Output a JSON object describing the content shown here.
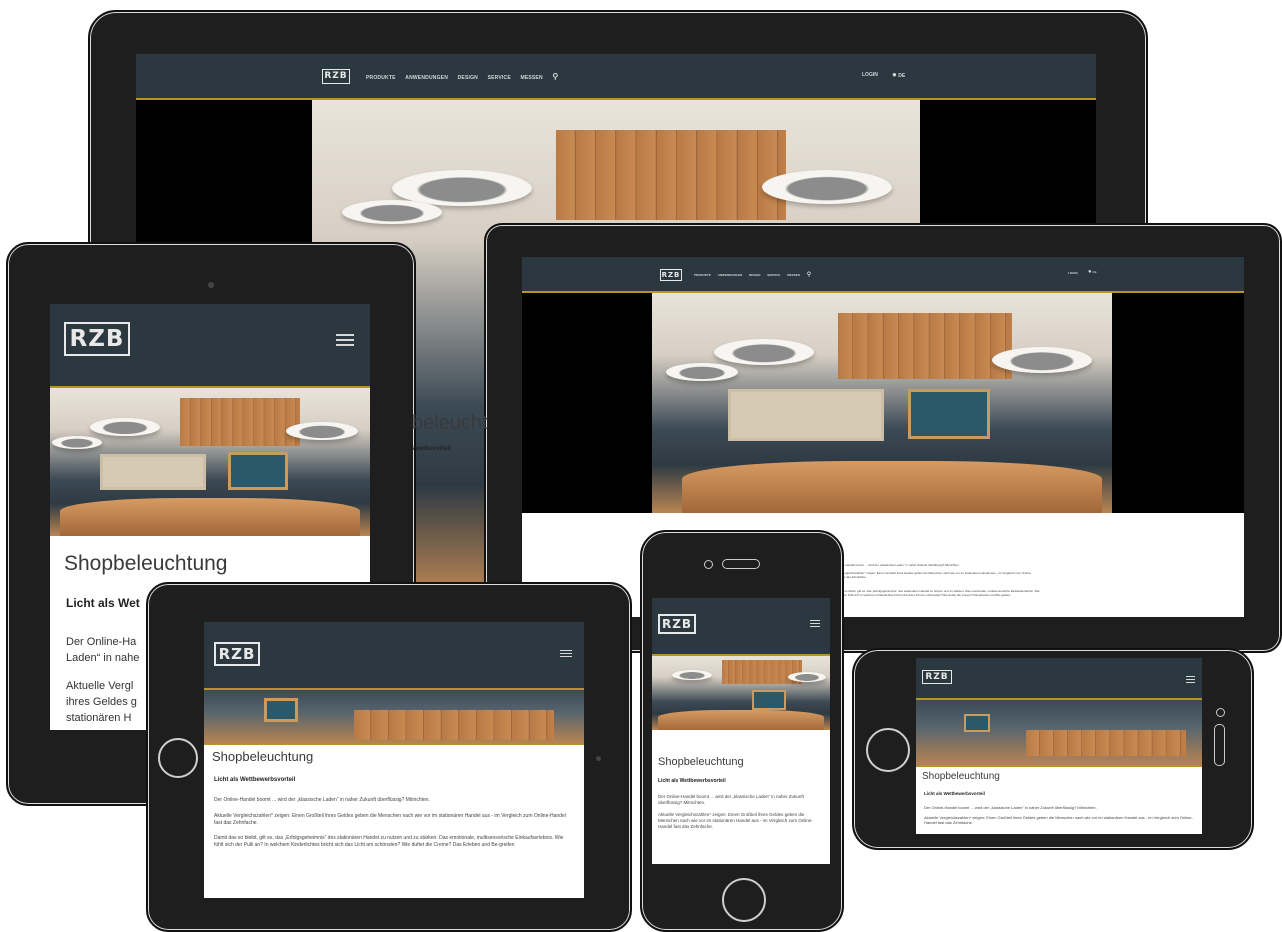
{
  "logo": "RZB",
  "nav": {
    "links": [
      "PRODUKTE",
      "ANWENDUNGEN",
      "DESIGN",
      "SERVICE",
      "MESSEN"
    ],
    "login": "LOGIN",
    "lang": "DE"
  },
  "content": {
    "title": "Shopbeleuchtung",
    "subtitle": "Licht als Wettbewerbsvorteil",
    "para1": "Der Online-Handel boomt ... wird der „klassische Laden“ in naher Zukunft überflüssig? Mitnichten.",
    "para2": "Aktuelle Vergleichszahlen* zeigen: Einen Großteil ihres Geldes geben die Menschen nach wie vor im stationären Handel aus - im Vergleich zum Online-Handel fast das Zehnfache.",
    "para3": "Damit das so bleibt, gilt es, das „Erfolgsgeheimnis“ des stationären Handel zu nutzen und zu stärken: Das emotionale, multisensorische Einkaufserlebnis. Wie fühlt sich der Pulli an? In welchem Kinderlichtes bricht sich das Licht am schönsten? Wie duftet die Creme? Das Erleben und Be-greifen",
    "tablet_partial_title": "beleucht",
    "tablet_partial_sub": "ewerbsvorteil",
    "tablet_partial_lines": [
      "Der Online-H",
      "Aktuelle Verg",
      "im Vergleich",
      "Damit das so",
      "multisensoris",
      "duftet die Cr",
      "Handel stärk"
    ],
    "ipad_partial_sub": "Licht als Wet",
    "ipad_partial_p1": [
      "Der Online-Ha",
      "Laden“ in nahe"
    ],
    "ipad_partial_p2": [
      "Aktuelle Vergl",
      "ihres Geldes g",
      "stationären H"
    ]
  },
  "colors": {
    "header": "#2c3840",
    "accent": "#b8922a",
    "bezel": "#1e1e1e"
  },
  "icons": [
    "search-icon",
    "globe-icon",
    "hamburger-menu-icon",
    "home-button-icon",
    "camera-icon",
    "speaker-icon"
  ]
}
